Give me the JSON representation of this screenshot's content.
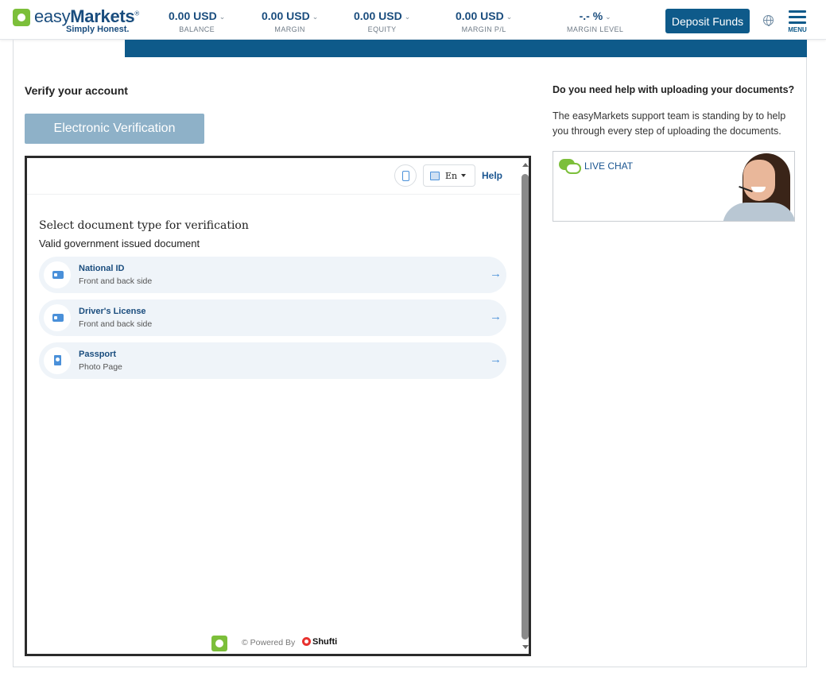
{
  "header": {
    "logo": {
      "word_light": "easy",
      "word_bold": "Markets",
      "registered": "®",
      "tagline": "Simply Honest."
    },
    "metrics": [
      {
        "value": "0.00 USD",
        "label": "BALANCE"
      },
      {
        "value": "0.00 USD",
        "label": "MARGIN"
      },
      {
        "value": "0.00 USD",
        "label": "EQUITY"
      },
      {
        "value": "0.00 USD",
        "label": "MARGIN P/L"
      },
      {
        "value": "-.- %",
        "label": "MARGIN LEVEL"
      }
    ],
    "deposit_label": "Deposit Funds",
    "menu_label": "MENU",
    "icons": {
      "globe": "globe-icon",
      "menu": "hamburger-menu-icon",
      "chevron": "chevron-down-icon"
    },
    "accent_color": "#0e5a8a"
  },
  "verify": {
    "title": "Verify your account",
    "ev_button_label": "Electronic Verification"
  },
  "iframe": {
    "lang_label": "En",
    "help_label": "Help",
    "doc_title": "Select document type for verification",
    "doc_subtitle": "Valid government issued document",
    "documents": [
      {
        "name": "National ID",
        "desc": "Front and back side",
        "icon": "id-card-icon"
      },
      {
        "name": "Driver's License",
        "desc": "Front and back side",
        "icon": "id-card-icon"
      },
      {
        "name": "Passport",
        "desc": "Photo Page",
        "icon": "passport-icon"
      }
    ],
    "powered_by": "© Powered By",
    "powered_brand": "Shufti"
  },
  "help": {
    "title": "Do you need help with uploading your documents?",
    "text": "The easyMarkets support team is standing by to help you through every step of uploading the documents.",
    "live_chat_label": "LIVE CHAT"
  }
}
